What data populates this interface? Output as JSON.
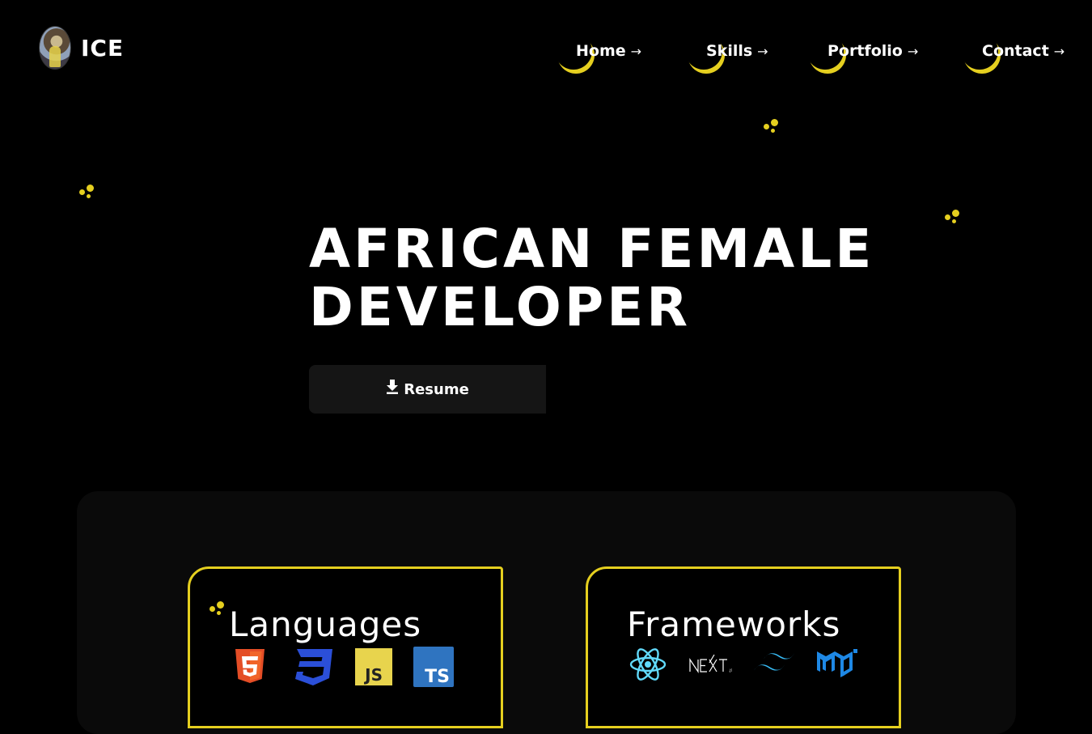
{
  "brand": {
    "name": "ICE"
  },
  "nav": {
    "items": [
      {
        "label": "Home",
        "arrow": "→"
      },
      {
        "label": "Skills",
        "arrow": "→"
      },
      {
        "label": "Portfolio",
        "arrow": "→"
      },
      {
        "label": "Contact",
        "arrow": "→"
      }
    ]
  },
  "hero": {
    "title_line1": "AFRICAN FEMALE",
    "title_line2": "DEVELOPER",
    "resume_label": "Resume",
    "resume_icon": "download-icon"
  },
  "skills": {
    "cards": [
      {
        "title": "Languages",
        "logos": [
          "html5-icon",
          "css3-icon",
          "javascript-icon",
          "typescript-icon"
        ]
      },
      {
        "title": "Frameworks",
        "logos": [
          "react-icon",
          "nextjs-icon",
          "tailwind-icon",
          "material-ui-icon"
        ]
      }
    ]
  },
  "colors": {
    "background": "#000000",
    "accent": "#e5cf1f",
    "panel": "#0a0a0a",
    "button": "#151515"
  }
}
